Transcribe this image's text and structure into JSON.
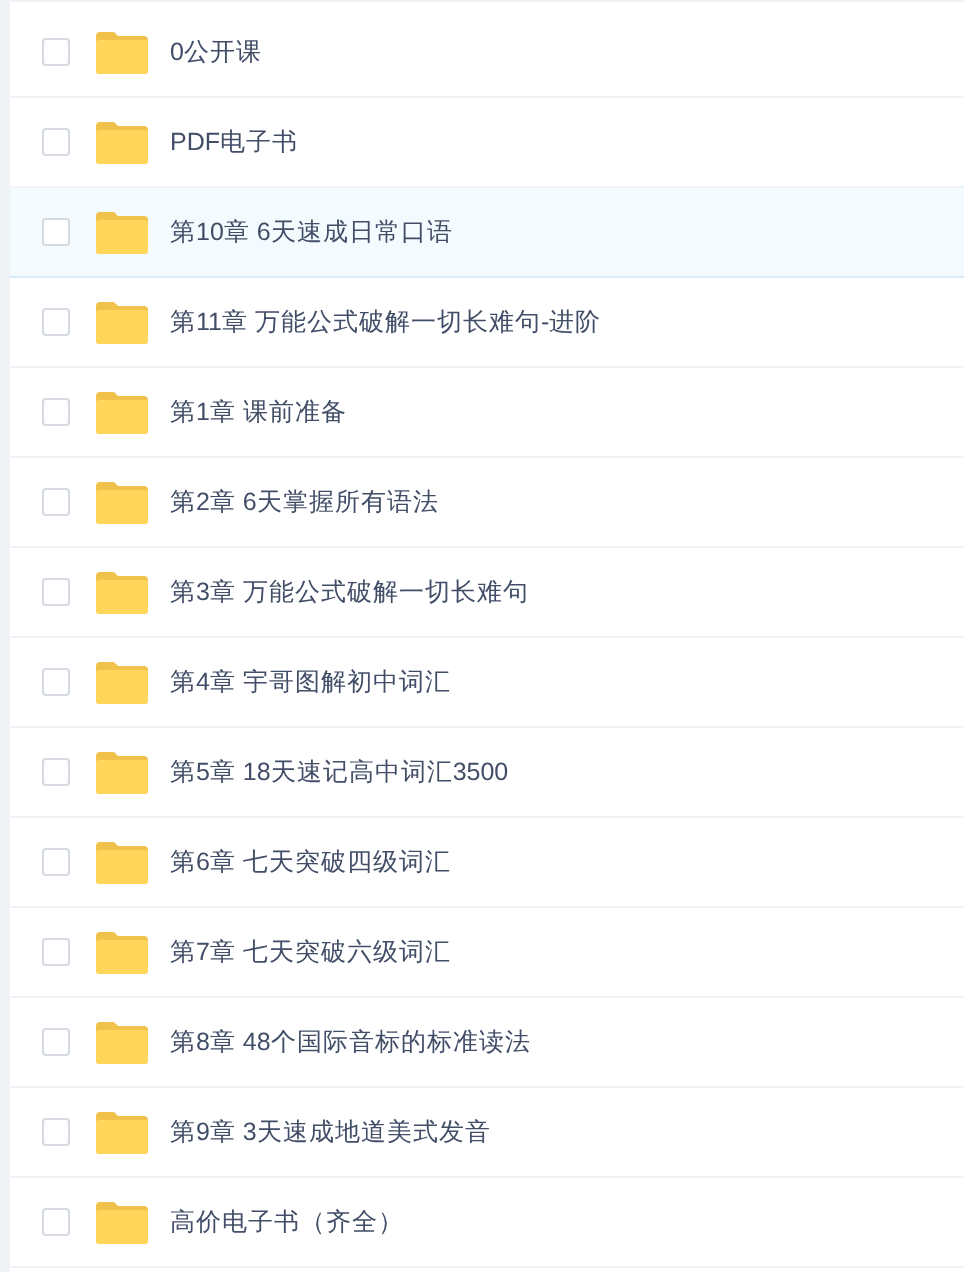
{
  "files": [
    {
      "name": "0公开课",
      "checked": false,
      "highlighted": false
    },
    {
      "name": "PDF电子书",
      "checked": false,
      "highlighted": false
    },
    {
      "name": "第10章 6天速成日常口语",
      "checked": false,
      "highlighted": true
    },
    {
      "name": "第11章 万能公式破解一切长难句-进阶",
      "checked": false,
      "highlighted": false
    },
    {
      "name": "第1章 课前准备",
      "checked": false,
      "highlighted": false
    },
    {
      "name": "第2章 6天掌握所有语法",
      "checked": false,
      "highlighted": false
    },
    {
      "name": "第3章 万能公式破解一切长难句",
      "checked": false,
      "highlighted": false
    },
    {
      "name": "第4章 宇哥图解初中词汇",
      "checked": false,
      "highlighted": false
    },
    {
      "name": "第5章 18天速记高中词汇3500",
      "checked": false,
      "highlighted": false
    },
    {
      "name": "第6章 七天突破四级词汇",
      "checked": false,
      "highlighted": false
    },
    {
      "name": "第7章 七天突破六级词汇",
      "checked": false,
      "highlighted": false
    },
    {
      "name": "第8章 48个国际音标的标准读法",
      "checked": false,
      "highlighted": false
    },
    {
      "name": "第9章 3天速成地道美式发音",
      "checked": false,
      "highlighted": false
    },
    {
      "name": "高价电子书（齐全）",
      "checked": false,
      "highlighted": false
    }
  ]
}
